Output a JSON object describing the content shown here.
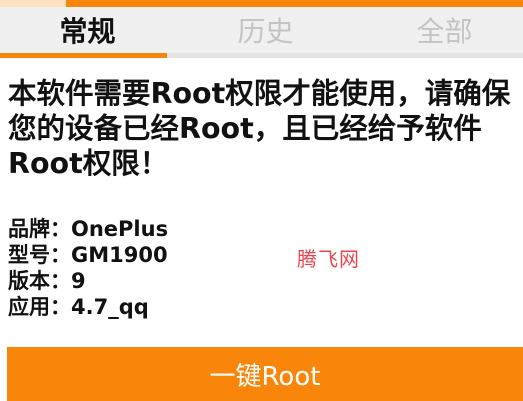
{
  "theme": {
    "accent": "#f9860b",
    "tabbar_bg": "#f0f0f0",
    "inactive_tab_text": "#c4c4c4",
    "watermark_color": "#e8454f"
  },
  "tabs": [
    {
      "label": "常规",
      "active": true
    },
    {
      "label": "历史",
      "active": false
    },
    {
      "label": "全部",
      "active": false
    }
  ],
  "notice": {
    "lines": [
      "本软件需要Root权限才能使用，请确保",
      "您的设备已经Root，且已经给予软件",
      "Root权限！"
    ]
  },
  "device_info": [
    {
      "label": "品牌：",
      "value": "OnePlus"
    },
    {
      "label": "型号：",
      "value": "GM1900"
    },
    {
      "label": "版本：",
      "value": "9"
    },
    {
      "label": "应用：",
      "value": "4.7_qq"
    }
  ],
  "watermark": "腾飞网",
  "action_button": {
    "label": "一键Root"
  }
}
